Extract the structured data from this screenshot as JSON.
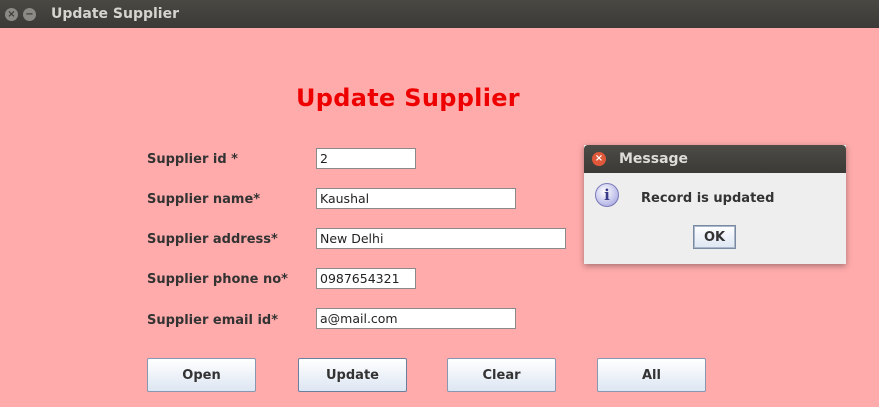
{
  "window": {
    "title": "Update Supplier",
    "close_icon": "×",
    "minimize_icon": "−"
  },
  "form": {
    "heading": "Update Supplier",
    "fields": [
      {
        "label": "Supplier id *",
        "value": "2"
      },
      {
        "label": "Supplier name*",
        "value": "Kaushal"
      },
      {
        "label": "Supplier address*",
        "value": "New Delhi"
      },
      {
        "label": "Supplier phone no*",
        "value": "0987654321"
      },
      {
        "label": "Supplier email id*",
        "value": "a@mail.com"
      }
    ],
    "buttons": {
      "open": "Open",
      "update": "Update",
      "clear": "Clear",
      "all": "All"
    }
  },
  "dialog": {
    "title": "Message",
    "icon": "i",
    "message": "Record is updated",
    "ok_label": "OK",
    "close_icon": "×"
  },
  "colors": {
    "background": "#ffabab",
    "heading": "#ee0000",
    "titlebar": "#3b3a36"
  }
}
